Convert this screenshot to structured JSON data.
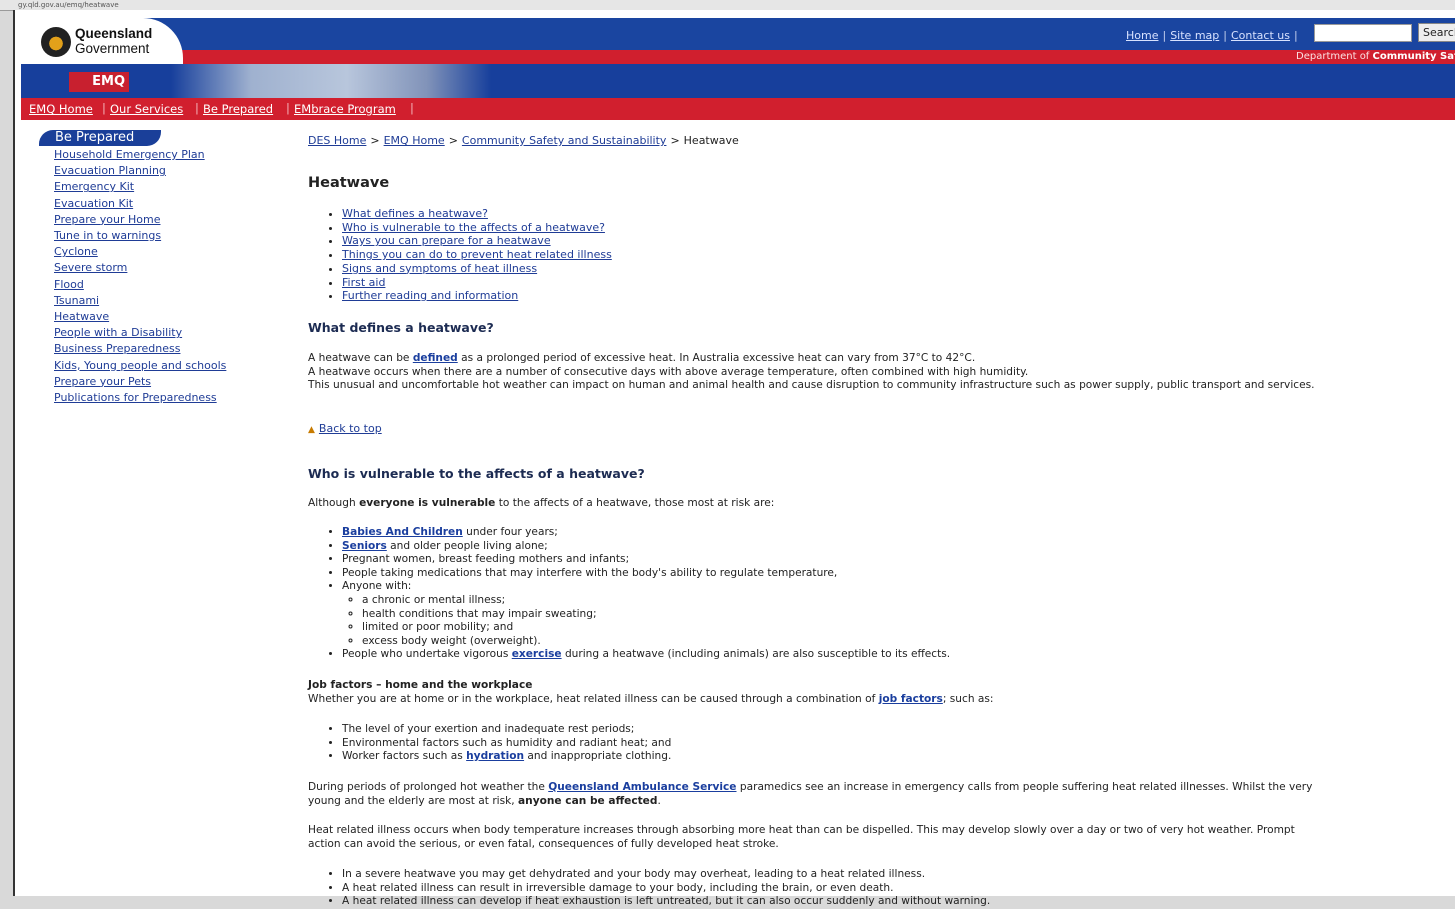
{
  "browser": {
    "address_text": "gy.qld.gov.au/emq/heatwave"
  },
  "header": {
    "brand_line1": "Queensland",
    "brand_line2": "Government",
    "top_links": [
      "Home",
      "Site map",
      "Contact us"
    ],
    "search_value": "",
    "search_button": "Search",
    "dept_prefix": "Department of",
    "dept_name": "Community Safety",
    "banner_logo_text": "EMQ"
  },
  "nav": [
    "EMQ Home",
    "Our Services",
    "Be Prepared",
    "EMbrace Program"
  ],
  "sidebar": {
    "heading": "Be Prepared",
    "items": [
      "Household Emergency Plan",
      "Evacuation Planning",
      "Emergency Kit",
      "Evacuation Kit",
      "Prepare your Home",
      "Tune in to warnings",
      "Cyclone",
      "Severe storm",
      "Flood",
      "Tsunami",
      "Heatwave",
      "People with a Disability",
      "Business Preparedness",
      "Kids, Young people and schools",
      "Prepare your Pets",
      "Publications for Preparedness"
    ]
  },
  "breadcrumb": {
    "items": [
      "DES Home",
      "EMQ Home",
      "Community Safety and Sustainability"
    ],
    "current": "Heatwave",
    "sep": ">"
  },
  "page_title": "Heatwave",
  "toc": [
    "What defines a heatwave?",
    "Who is vulnerable to the affects of a heatwave?",
    "Ways you can prepare for a heatwave",
    "Things you can do to prevent heat related illness",
    "Signs and symptoms of heat illness",
    "First aid",
    "Further reading and information"
  ],
  "section1": {
    "heading": "What defines a heatwave?",
    "p1_pre": "A heatwave can be ",
    "p1_link": "defined",
    "p1_post": " as a prolonged period of excessive heat.  In Australia excessive heat can vary from 37°C to 42°C.",
    "p2": "A heatwave occurs when there are a number of consecutive days with above average temperature, often combined with high humidity.",
    "p3": "This unusual and uncomfortable hot weather can impact on human and animal health and cause disruption to community infrastructure such as power supply, public transport and services.",
    "back_to_top": "Back to top"
  },
  "section2": {
    "heading": "Who is vulnerable to the affects of a heatwave?",
    "intro_pre": "Although ",
    "intro_bold": "everyone is vulnerable",
    "intro_post": " to the affects of a heatwave, those most at risk are:",
    "b1_link": "Babies And Children",
    "b1_post": " under four years;",
    "b2_link": "Seniors",
    "b2_post": " and older people living alone;",
    "b3": "Pregnant women, breast feeding mothers and infants;",
    "b4": "People taking medications that may interfere with the body's ability to regulate temperature,",
    "b5": "Anyone with:",
    "sub": [
      "a chronic or mental illness;",
      "health conditions that may impair sweating;",
      "limited or poor mobility; and",
      "excess body weight (overweight)."
    ],
    "b6_pre": "People who undertake vigorous ",
    "b6_link": "exercise",
    "b6_post": " during a heatwave (including animals) are also susceptible to its effects."
  },
  "job": {
    "heading": "Job factors – home and the workplace",
    "intro_pre": "Whether you are at home or in the workplace, heat related illness can be caused through a combination of ",
    "intro_link": "job factors",
    "intro_post": "; such as:",
    "b1": "The level of your exertion and inadequate rest periods;",
    "b2": "Environmental factors such as humidity and radiant heat; and",
    "b3_pre": "Worker factors such as ",
    "b3_link": "hydration",
    "b3_post": " and inappropriate clothing."
  },
  "qas": {
    "pre": "During periods of prolonged hot weather the ",
    "link": "Queensland Ambulance Service",
    "mid": " paramedics see an increase in emergency calls from people suffering heat related illnesses.  Whilst the very young and the elderly are most at risk, ",
    "bold": "anyone can be affected",
    "post": "."
  },
  "illness": {
    "p": "Heat related illness occurs when body temperature increases through absorbing more heat than can be dispelled.  This may develop slowly over a day or two of very hot weather. Prompt action can avoid the serious, or even fatal, consequences of fully developed heat stroke.",
    "b1": "In a severe heatwave you may get dehydrated and your body may overheat, leading to a heat related illness.",
    "b2": "A heat related illness can result in irreversible damage to your body, including the brain, or even death.",
    "b3": "A heat related illness can develop if heat exhaustion is left untreated, but it can also occur suddenly and without warning."
  },
  "colors": {
    "header_blue": "#1a45a0",
    "header_red": "#d01f2e",
    "link": "#1f3c96"
  }
}
